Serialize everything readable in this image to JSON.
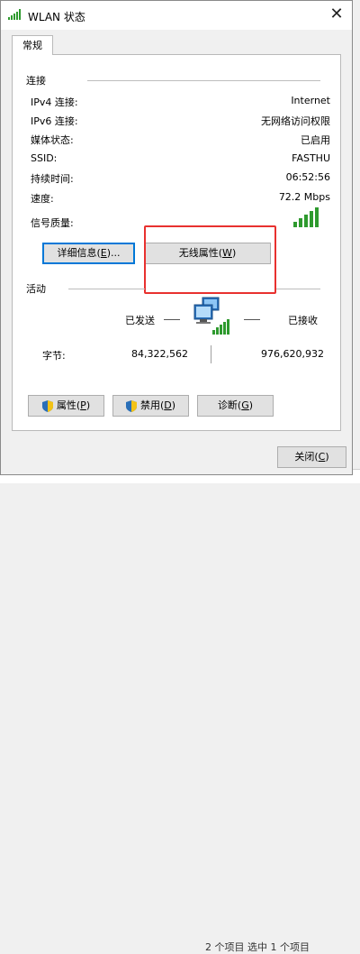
{
  "window": {
    "title": "WLAN 状态",
    "close_glyph": "✕"
  },
  "tab": {
    "label": "常规"
  },
  "connection": {
    "group_label": "连接",
    "rows": [
      {
        "label": "IPv4 连接:",
        "value": "Internet"
      },
      {
        "label": "IPv6 连接:",
        "value": "无网络访问权限"
      },
      {
        "label": "媒体状态:",
        "value": "已启用"
      },
      {
        "label": "SSID:",
        "value": "FASTHU"
      },
      {
        "label": "持续时间:",
        "value": "06:52:56"
      },
      {
        "label": "速度:",
        "value": "72.2 Mbps"
      }
    ],
    "signal_label": "信号质量:",
    "signal_bars": 5,
    "details_button": {
      "text": "详细信息(",
      "mnemonic": "E",
      "suffix": ")..."
    },
    "wireless_button": {
      "text": "无线属性(",
      "mnemonic": "W",
      "suffix": ")"
    }
  },
  "activity": {
    "group_label": "活动",
    "sent_label": "已发送",
    "received_label": "已接收",
    "bytes_label": "字节:",
    "bytes_sent": "84,322,562",
    "bytes_received": "976,620,932"
  },
  "buttons": {
    "properties": {
      "text": "属性(",
      "mnemonic": "P",
      "suffix": ")"
    },
    "disable": {
      "text": "禁用(",
      "mnemonic": "D",
      "suffix": ")"
    },
    "diagnose": {
      "text": "诊断(",
      "mnemonic": "G",
      "suffix": ")"
    },
    "close": {
      "text": "关闭(",
      "mnemonic": "C",
      "suffix": ")"
    }
  },
  "background": {
    "status_text": "2 个项目    选中 1 个项目"
  },
  "colors": {
    "accent": "#0078d7",
    "highlight": "#e8312f",
    "signal": "#2e9a2e"
  }
}
